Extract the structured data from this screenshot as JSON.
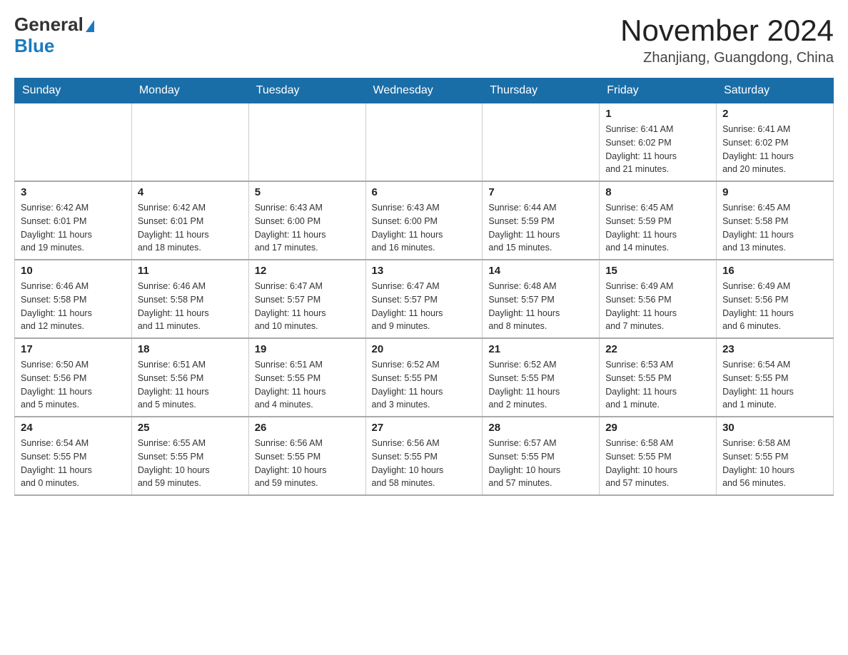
{
  "header": {
    "logo": {
      "general": "General",
      "blue": "Blue"
    },
    "title": "November 2024",
    "location": "Zhanjiang, Guangdong, China"
  },
  "days_of_week": [
    "Sunday",
    "Monday",
    "Tuesday",
    "Wednesday",
    "Thursday",
    "Friday",
    "Saturday"
  ],
  "weeks": [
    [
      {
        "day": "",
        "info": ""
      },
      {
        "day": "",
        "info": ""
      },
      {
        "day": "",
        "info": ""
      },
      {
        "day": "",
        "info": ""
      },
      {
        "day": "",
        "info": ""
      },
      {
        "day": "1",
        "info": "Sunrise: 6:41 AM\nSunset: 6:02 PM\nDaylight: 11 hours\nand 21 minutes."
      },
      {
        "day": "2",
        "info": "Sunrise: 6:41 AM\nSunset: 6:02 PM\nDaylight: 11 hours\nand 20 minutes."
      }
    ],
    [
      {
        "day": "3",
        "info": "Sunrise: 6:42 AM\nSunset: 6:01 PM\nDaylight: 11 hours\nand 19 minutes."
      },
      {
        "day": "4",
        "info": "Sunrise: 6:42 AM\nSunset: 6:01 PM\nDaylight: 11 hours\nand 18 minutes."
      },
      {
        "day": "5",
        "info": "Sunrise: 6:43 AM\nSunset: 6:00 PM\nDaylight: 11 hours\nand 17 minutes."
      },
      {
        "day": "6",
        "info": "Sunrise: 6:43 AM\nSunset: 6:00 PM\nDaylight: 11 hours\nand 16 minutes."
      },
      {
        "day": "7",
        "info": "Sunrise: 6:44 AM\nSunset: 5:59 PM\nDaylight: 11 hours\nand 15 minutes."
      },
      {
        "day": "8",
        "info": "Sunrise: 6:45 AM\nSunset: 5:59 PM\nDaylight: 11 hours\nand 14 minutes."
      },
      {
        "day": "9",
        "info": "Sunrise: 6:45 AM\nSunset: 5:58 PM\nDaylight: 11 hours\nand 13 minutes."
      }
    ],
    [
      {
        "day": "10",
        "info": "Sunrise: 6:46 AM\nSunset: 5:58 PM\nDaylight: 11 hours\nand 12 minutes."
      },
      {
        "day": "11",
        "info": "Sunrise: 6:46 AM\nSunset: 5:58 PM\nDaylight: 11 hours\nand 11 minutes."
      },
      {
        "day": "12",
        "info": "Sunrise: 6:47 AM\nSunset: 5:57 PM\nDaylight: 11 hours\nand 10 minutes."
      },
      {
        "day": "13",
        "info": "Sunrise: 6:47 AM\nSunset: 5:57 PM\nDaylight: 11 hours\nand 9 minutes."
      },
      {
        "day": "14",
        "info": "Sunrise: 6:48 AM\nSunset: 5:57 PM\nDaylight: 11 hours\nand 8 minutes."
      },
      {
        "day": "15",
        "info": "Sunrise: 6:49 AM\nSunset: 5:56 PM\nDaylight: 11 hours\nand 7 minutes."
      },
      {
        "day": "16",
        "info": "Sunrise: 6:49 AM\nSunset: 5:56 PM\nDaylight: 11 hours\nand 6 minutes."
      }
    ],
    [
      {
        "day": "17",
        "info": "Sunrise: 6:50 AM\nSunset: 5:56 PM\nDaylight: 11 hours\nand 5 minutes."
      },
      {
        "day": "18",
        "info": "Sunrise: 6:51 AM\nSunset: 5:56 PM\nDaylight: 11 hours\nand 5 minutes."
      },
      {
        "day": "19",
        "info": "Sunrise: 6:51 AM\nSunset: 5:55 PM\nDaylight: 11 hours\nand 4 minutes."
      },
      {
        "day": "20",
        "info": "Sunrise: 6:52 AM\nSunset: 5:55 PM\nDaylight: 11 hours\nand 3 minutes."
      },
      {
        "day": "21",
        "info": "Sunrise: 6:52 AM\nSunset: 5:55 PM\nDaylight: 11 hours\nand 2 minutes."
      },
      {
        "day": "22",
        "info": "Sunrise: 6:53 AM\nSunset: 5:55 PM\nDaylight: 11 hours\nand 1 minute."
      },
      {
        "day": "23",
        "info": "Sunrise: 6:54 AM\nSunset: 5:55 PM\nDaylight: 11 hours\nand 1 minute."
      }
    ],
    [
      {
        "day": "24",
        "info": "Sunrise: 6:54 AM\nSunset: 5:55 PM\nDaylight: 11 hours\nand 0 minutes."
      },
      {
        "day": "25",
        "info": "Sunrise: 6:55 AM\nSunset: 5:55 PM\nDaylight: 10 hours\nand 59 minutes."
      },
      {
        "day": "26",
        "info": "Sunrise: 6:56 AM\nSunset: 5:55 PM\nDaylight: 10 hours\nand 59 minutes."
      },
      {
        "day": "27",
        "info": "Sunrise: 6:56 AM\nSunset: 5:55 PM\nDaylight: 10 hours\nand 58 minutes."
      },
      {
        "day": "28",
        "info": "Sunrise: 6:57 AM\nSunset: 5:55 PM\nDaylight: 10 hours\nand 57 minutes."
      },
      {
        "day": "29",
        "info": "Sunrise: 6:58 AM\nSunset: 5:55 PM\nDaylight: 10 hours\nand 57 minutes."
      },
      {
        "day": "30",
        "info": "Sunrise: 6:58 AM\nSunset: 5:55 PM\nDaylight: 10 hours\nand 56 minutes."
      }
    ]
  ]
}
